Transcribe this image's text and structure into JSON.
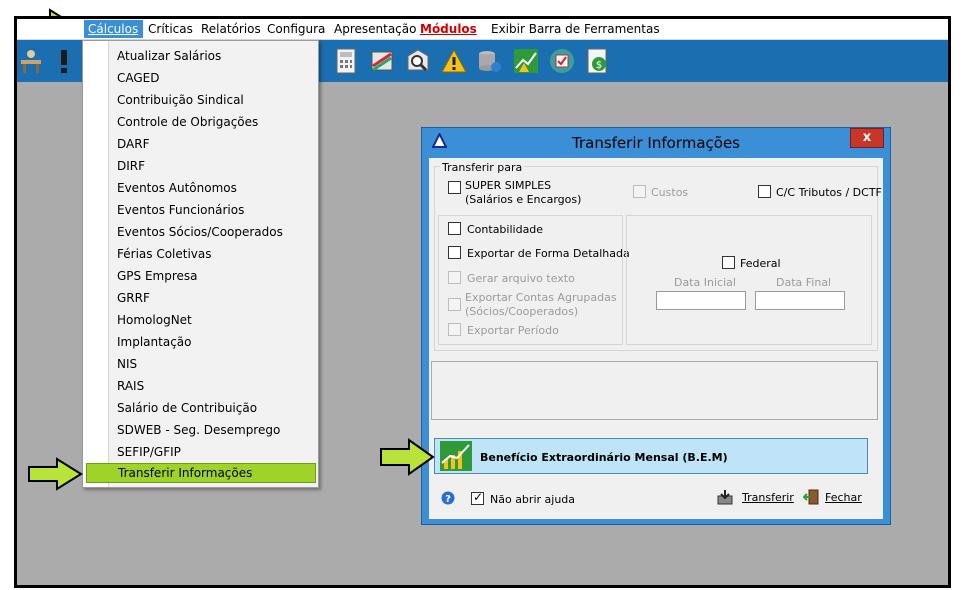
{
  "menubar": {
    "items": [
      "Cálculos",
      "Críticas",
      "Relatórios",
      "Configura",
      "Apresentação",
      "Módulos",
      "Exibir Barra de Ferramentas"
    ]
  },
  "dropdown": {
    "items": [
      "Atualizar Salários",
      "CAGED",
      "Contribuição Sindical",
      "Controle de Obrigações",
      "DARF",
      "DIRF",
      "Eventos Autônomos",
      "Eventos Funcionários",
      "Eventos Sócios/Cooperados",
      "Férias Coletivas",
      "GPS Empresa",
      "GRRF",
      "HomologNet",
      "Implantação",
      "NIS",
      "RAIS",
      "Salário de Contribuição",
      "SDWEB - Seg. Desemprego",
      "SEFIP/GFIP",
      "Transferir Informações"
    ],
    "selected_index": 19
  },
  "dialog": {
    "title": "Transferir Informações",
    "close_label": "x",
    "group_label": "Transferir para",
    "super_simples_line1": "SUPER SIMPLES",
    "super_simples_line2": "(Salários e Encargos)",
    "custos": "Custos",
    "cc_tributos": "C/C Tributos / DCTF",
    "contabilidade": "Contabilidade",
    "exportar_detalhada": "Exportar de Forma Detalhada",
    "gerar_arquivo": "Gerar arquivo texto",
    "exportar_contas_line1": "Exportar Contas Agrupadas",
    "exportar_contas_line2": "(Sócios/Cooperados)",
    "exportar_periodo": "Exportar Período",
    "federal": "Federal",
    "data_inicial": "Data Inicial",
    "data_final": "Data Final",
    "bem_label": "Benefício Extraordinário Mensal (B.E.M)",
    "nao_abrir_ajuda": "Não abrir ajuda",
    "transferir": "Transferir",
    "fechar": "Fechar",
    "nao_abrir_checked": true
  },
  "colors": {
    "accent": "#3b8fd6",
    "toolbar": "#1b6fb0",
    "highlight_green": "#9fd32a",
    "modulos_red": "#d00000",
    "bem_bg": "#bfe4f8"
  },
  "icons": [
    "menu-arrow-icon",
    "dropdown-arrow-icon",
    "bem-arrow-icon",
    "help-icon",
    "transferir-icon",
    "fechar-icon"
  ]
}
